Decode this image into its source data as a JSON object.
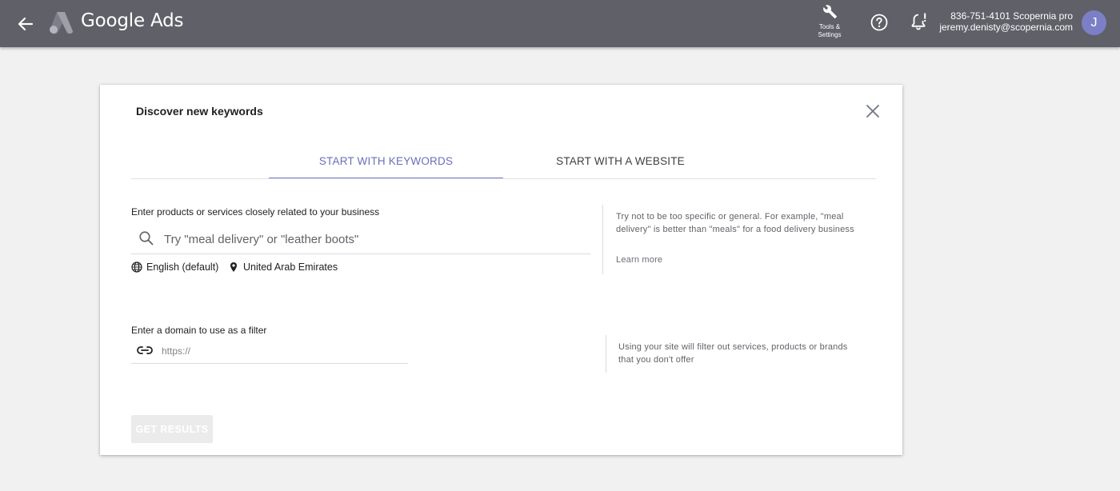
{
  "header": {
    "brand": "Google Ads",
    "tools_label_line1": "Tools &",
    "tools_label_line2": "Settings",
    "account_name": "836-751-4101 Scopernia pro",
    "account_email": "jeremy.denisty@scopernia.com",
    "avatar_initial": "J",
    "icons": [
      "back-arrow-icon",
      "google-ads-logo",
      "wrench-icon",
      "help-icon",
      "bell-icon"
    ]
  },
  "dialog": {
    "title": "Discover new keywords",
    "tabs": [
      {
        "label": "START WITH KEYWORDS",
        "active": true
      },
      {
        "label": "START WITH A WEBSITE",
        "active": false
      }
    ],
    "keywords": {
      "label": "Enter products or services closely related to your business",
      "placeholder": "Try \"meal delivery\" or \"leather boots\"",
      "language": "English (default)",
      "location": "United Arab Emirates",
      "hint": "Try not to be too specific or general. For example, \"meal delivery\" is better than \"meals\" for a food delivery business",
      "learn_more": "Learn more"
    },
    "domain": {
      "label": "Enter a domain to use as a filter",
      "placeholder": "https://",
      "hint": "Using your site will filter out services, products or brands that you don't offer"
    },
    "submit_label": "GET RESULTS",
    "submit_enabled": false
  },
  "colors": {
    "topbar": "#5f6068",
    "accent": "#6a6fb7",
    "avatar": "#7b7fc6",
    "page_bg": "#f1f1f1"
  }
}
